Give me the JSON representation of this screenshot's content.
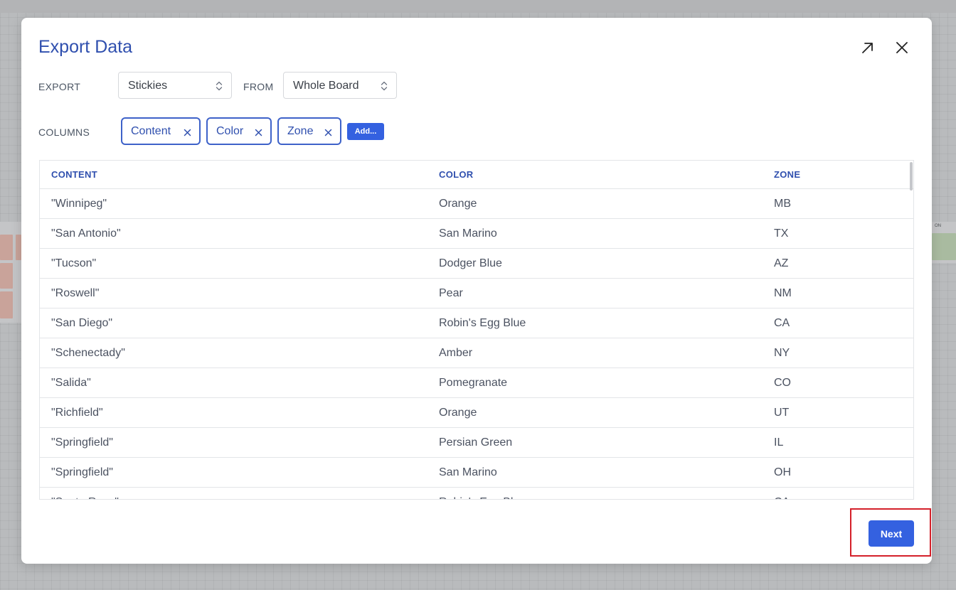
{
  "modal": {
    "title": "Export Data",
    "export_label": "EXPORT",
    "export_value": "Stickies",
    "from_label": "FROM",
    "from_value": "Whole Board",
    "columns_label": "COLUMNS",
    "chips": [
      "Content",
      "Color",
      "Zone"
    ],
    "add_label": "Add...",
    "next_label": "Next"
  },
  "table": {
    "headers": [
      "CONTENT",
      "COLOR",
      "ZONE"
    ],
    "rows": [
      [
        "\"Winnipeg\"",
        "Orange",
        "MB"
      ],
      [
        "\"San Antonio\"",
        "San Marino",
        "TX"
      ],
      [
        "\"Tucson\"",
        "Dodger Blue",
        "AZ"
      ],
      [
        "\"Roswell\"",
        "Pear",
        "NM"
      ],
      [
        "\"San Diego\"",
        "Robin's Egg Blue",
        "CA"
      ],
      [
        "\"Schenectady\"",
        "Amber",
        "NY"
      ],
      [
        "\"Salida\"",
        "Pomegranate",
        "CO"
      ],
      [
        "\"Richfield\"",
        "Orange",
        "UT"
      ],
      [
        "\"Springfield\"",
        "Persian Green",
        "IL"
      ],
      [
        "\"Springfield\"",
        "San Marino",
        "OH"
      ],
      [
        "\"Santa Rosa\"",
        "Robin's Egg Blue",
        "CA"
      ]
    ]
  },
  "icons": {
    "expand": "arrow-up-right-icon",
    "close": "close-icon",
    "chip_remove": "close-icon",
    "select_caret": "chevron-up-down-icon"
  },
  "colors": {
    "accent": "#3461e0",
    "title": "#2f4fae",
    "highlight": "#d4202a"
  },
  "background": {
    "label": "ON"
  }
}
